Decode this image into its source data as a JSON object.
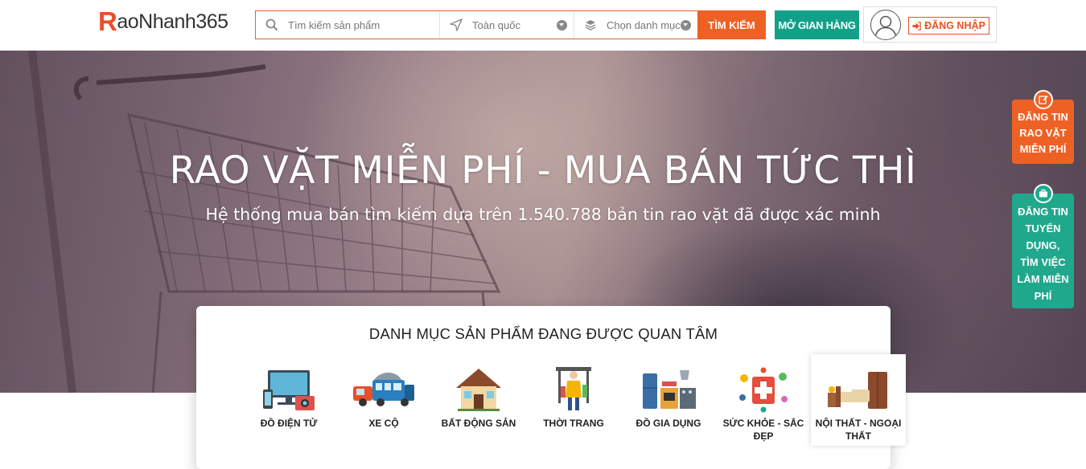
{
  "header": {
    "logo": {
      "r": "R",
      "rest": "aoNhanh",
      "num": "365"
    },
    "search": {
      "placeholder": "Tìm kiếm sản phẩm",
      "location": "Toàn quốc",
      "category": "Chọn danh mục"
    },
    "search_button": "TÌM KIẾM",
    "shop_button": "MỞ GIAN HÀNG",
    "login_button": "ĐĂNG NHẬP"
  },
  "hero": {
    "title": "RAO VẶT MIỄN PHÍ - MUA BÁN TỨC THÌ",
    "subtitle": "Hệ thống mua bán tìm kiếm dựa trên 1.540.788 bản tin rao vặt đã được xác minh"
  },
  "side": {
    "post": [
      "ĐĂNG TIN",
      "RAO VẶT",
      "MIỄN PHÍ"
    ],
    "job": [
      "ĐĂNG TIN",
      "TUYỂN",
      "DỤNG,",
      "TÌM VIỆC",
      "LÀM MIỄN",
      "PHÍ"
    ]
  },
  "categories": {
    "title": "DANH MỤC SẢN PHẨM ĐANG ĐƯỢC QUAN TÂM",
    "items": [
      {
        "label": "ĐỒ ĐIỆN TỬ",
        "icon": "electronics-icon"
      },
      {
        "label": "XE CỘ",
        "icon": "vehicles-icon"
      },
      {
        "label": "BẤT ĐỘNG SẢN",
        "icon": "real-estate-icon"
      },
      {
        "label": "THỜI TRANG",
        "icon": "fashion-icon"
      },
      {
        "label": "ĐỒ GIA DỤNG",
        "icon": "household-icon"
      },
      {
        "label": "SỨC KHỎE - SẮC ĐẸP",
        "icon": "health-beauty-icon"
      },
      {
        "label": "NỘI THẤT - NGOẠI THẤT",
        "icon": "furniture-icon"
      }
    ]
  },
  "colors": {
    "brand_orange": "#ee6125",
    "brand_green": "#12a188"
  }
}
